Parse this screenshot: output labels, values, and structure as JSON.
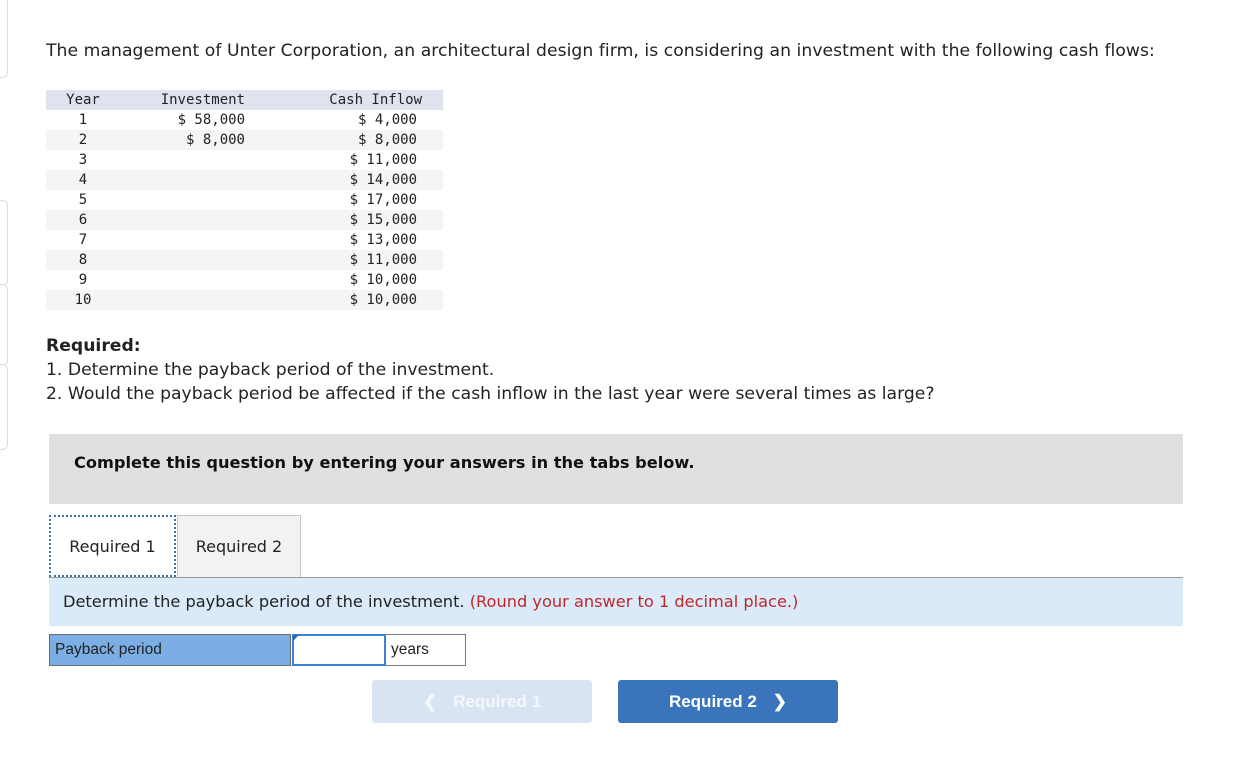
{
  "intro": "The management of Unter Corporation, an architectural design firm, is considering an investment with the following cash flows:",
  "cash_flow_table": {
    "headers": [
      "Year",
      "Investment",
      "Cash Inflow"
    ],
    "rows": [
      {
        "year": "1",
        "investment": "$ 58,000",
        "cash_inflow": "$ 4,000"
      },
      {
        "year": "2",
        "investment": "$ 8,000",
        "cash_inflow": "$ 8,000"
      },
      {
        "year": "3",
        "investment": "",
        "cash_inflow": "$ 11,000"
      },
      {
        "year": "4",
        "investment": "",
        "cash_inflow": "$ 14,000"
      },
      {
        "year": "5",
        "investment": "",
        "cash_inflow": "$ 17,000"
      },
      {
        "year": "6",
        "investment": "",
        "cash_inflow": "$ 15,000"
      },
      {
        "year": "7",
        "investment": "",
        "cash_inflow": "$ 13,000"
      },
      {
        "year": "8",
        "investment": "",
        "cash_inflow": "$ 11,000"
      },
      {
        "year": "9",
        "investment": "",
        "cash_inflow": "$ 10,000"
      },
      {
        "year": "10",
        "investment": "",
        "cash_inflow": "$ 10,000"
      }
    ]
  },
  "required": {
    "heading": "Required:",
    "items": [
      "1. Determine the payback period of the investment.",
      "2. Would the payback period be affected if the cash inflow in the last year were several times as large?"
    ]
  },
  "instruction": "Complete this question by entering your answers in the tabs below.",
  "tabs": [
    {
      "label": "Required 1",
      "active": true
    },
    {
      "label": "Required 2",
      "active": false
    }
  ],
  "prompt": {
    "text": "Determine the payback period of the investment.",
    "hint": "(Round your answer to 1 decimal place.)"
  },
  "answer": {
    "label": "Payback period",
    "value": "",
    "unit": "years"
  },
  "navigation": {
    "prev_label": "Required 1",
    "next_label": "Required 2",
    "prev_icon": "chevron-left-icon",
    "next_icon": "chevron-right-icon"
  },
  "colors": {
    "accent": "#3a75bb",
    "hint": "#c0272d",
    "label_bg": "#7aaee4",
    "prompt_bg": "#daeaf8"
  }
}
